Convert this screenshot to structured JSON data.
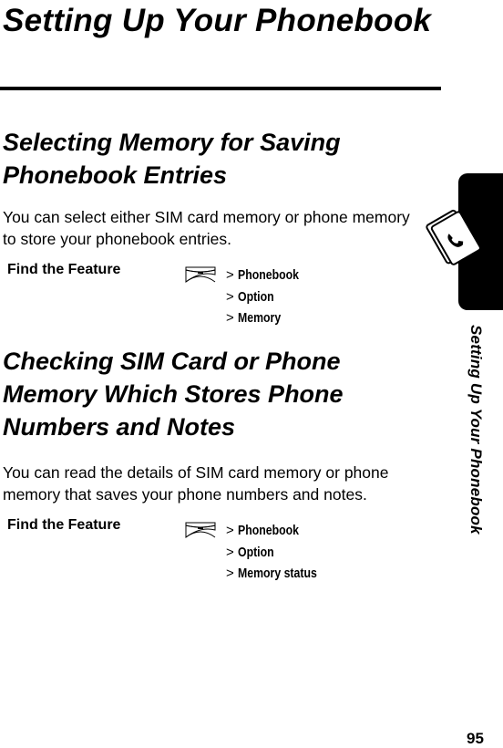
{
  "page": {
    "title": "Setting Up Your Phonebook",
    "side_tab_label": "Setting Up Your Phonebook",
    "page_number": "95"
  },
  "sections": [
    {
      "heading": "Selecting Memory for Saving Phonebook Entries",
      "body": "You can select either SIM card memory or phone memory to store your phonebook entries.",
      "find_feature": {
        "label": "Find the Feature",
        "key_icon": "menu-key-icon",
        "path": [
          {
            "sep": ">",
            "label": "Phonebook"
          },
          {
            "sep": ">",
            "label": "Option"
          },
          {
            "sep": ">",
            "label": "Memory"
          }
        ]
      }
    },
    {
      "heading": "Checking SIM Card or Phone Memory Which Stores Phone Numbers and Notes",
      "body": "You can read the details of SIM card memory or phone memory that saves your phone numbers and notes.",
      "find_feature": {
        "label": "Find the Feature",
        "key_icon": "menu-key-icon",
        "path": [
          {
            "sep": ">",
            "label": "Phonebook"
          },
          {
            "sep": ">",
            "label": "Option"
          },
          {
            "sep": ">",
            "label": "Memory status"
          }
        ]
      }
    }
  ]
}
